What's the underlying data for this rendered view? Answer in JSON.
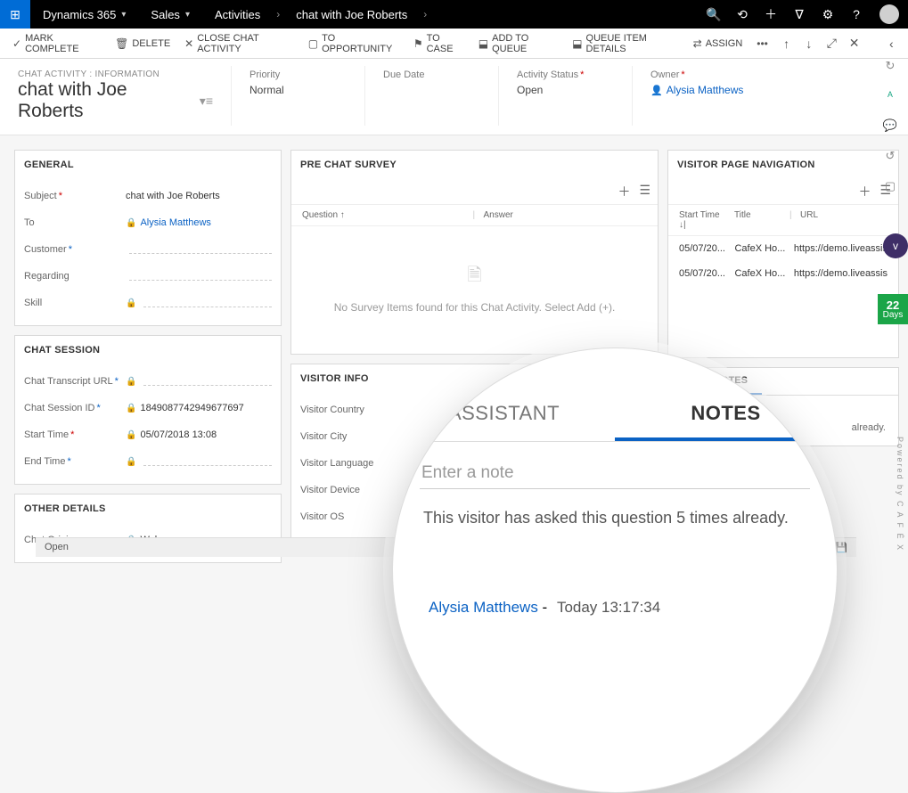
{
  "topnav": {
    "brand": "Dynamics 365",
    "area": "Sales",
    "crumb1": "Activities",
    "crumb2": "chat with Joe Roberts"
  },
  "cmd": {
    "mark": "MARK COMPLETE",
    "delete": "DELETE",
    "close": "CLOSE CHAT ACTIVITY",
    "opp": "TO OPPORTUNITY",
    "case": "TO CASE",
    "queue": "ADD TO QUEUE",
    "qitem": "QUEUE ITEM DETAILS",
    "assign": "ASSIGN"
  },
  "header": {
    "pagetype": "CHAT ACTIVITY : INFORMATION",
    "title": "chat with Joe Roberts",
    "priority_lbl": "Priority",
    "priority": "Normal",
    "due_lbl": "Due Date",
    "due": "",
    "status_lbl": "Activity Status",
    "status": "Open",
    "owner_lbl": "Owner",
    "owner": "Alysia Matthews"
  },
  "general": {
    "title": "GENERAL",
    "subject_lbl": "Subject",
    "subject": "chat with Joe Roberts",
    "to_lbl": "To",
    "to": "Alysia Matthews",
    "customer_lbl": "Customer",
    "regarding_lbl": "Regarding",
    "skill_lbl": "Skill"
  },
  "session": {
    "title": "CHAT SESSION",
    "url_lbl": "Chat Transcript URL",
    "id_lbl": "Chat Session ID",
    "id": "1849087742949677697",
    "start_lbl": "Start Time",
    "start": "05/07/2018  13:08",
    "end_lbl": "End Time"
  },
  "other": {
    "title": "OTHER DETAILS",
    "origin_lbl": "Chat Origin",
    "origin": "Web"
  },
  "survey": {
    "title": "PRE CHAT SURVEY",
    "col_q": "Question",
    "col_a": "Answer",
    "empty": "No Survey Items found for this Chat Activity. Select Add (+)."
  },
  "vinfo": {
    "title": "VISITOR INFO",
    "country": "Visitor Country",
    "city": "Visitor City",
    "lang": "Visitor Language",
    "dev": "Visitor Device",
    "os": "Visitor OS"
  },
  "vnav": {
    "title": "VISITOR PAGE NAVIGATION",
    "col_time": "Start Time",
    "col_title": "Title",
    "col_url": "URL",
    "rows": [
      {
        "t": "05/07/20...",
        "title": "CafeX Ho...",
        "url": "https://demo.liveassis"
      },
      {
        "t": "05/07/20...",
        "title": "CafeX Ho...",
        "url": "https://demo.liveassis"
      }
    ]
  },
  "notes": {
    "tab_a": "ASSISTANT",
    "tab_b": "NOTES",
    "truncated": "already."
  },
  "mag": {
    "tab_a": "ASSISTANT",
    "tab_b": "NOTES",
    "placeholder": "Enter a note",
    "body": "This visitor has asked this question 5 times already.",
    "author": "Alysia Matthews",
    "time": "Today 13:17:34"
  },
  "footer": {
    "status": "Open"
  },
  "badge": {
    "days": "22",
    "days_lbl": "Days"
  }
}
